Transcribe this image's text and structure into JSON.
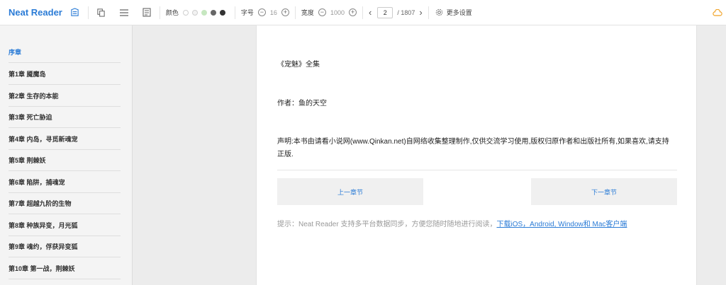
{
  "toolbar": {
    "app_name": "Neat Reader",
    "color_label": "颜色",
    "font_label": "字号",
    "font_size": "16",
    "width_label": "宽度",
    "width_value": "1000",
    "page_current": "2",
    "page_total": "/ 1807",
    "more_settings": "更多设置",
    "color_dots": [
      "#ffffff",
      "#f2f2f2",
      "#c6e7c0",
      "#666666",
      "#333333"
    ]
  },
  "sidebar": {
    "items": [
      {
        "label": "序章",
        "active": true
      },
      {
        "label": "第1章 魇魔岛"
      },
      {
        "label": "第2章 生存的本能"
      },
      {
        "label": "第3章 死亡胁迫"
      },
      {
        "label": "第4章 内岛，寻觅新魂宠"
      },
      {
        "label": "第5章 荆棘妖"
      },
      {
        "label": "第6章 陷阱，捕魂宠"
      },
      {
        "label": "第7章 超越九阶的生物"
      },
      {
        "label": "第8章 种族异变，月光狐"
      },
      {
        "label": "第9章 魂约，俘获异变狐"
      },
      {
        "label": "第10章 第一战，荆棘妖"
      }
    ]
  },
  "content": {
    "title": "《宠魅》全集",
    "author": "作者：鱼的天空",
    "statement_line1": "声明:本书由请看小说网(www.Qinkan.net)自网络收集整理制作,仅供交流学习使用,版权归原作者和出版社所有,如果喜欢,请支持",
    "statement_line2": "正版.",
    "prev_chapter": "上一章节",
    "next_chapter": "下一章节",
    "hint_text": "提示：Neat Reader 支持多平台数据同步，方便您随时随地进行阅读，",
    "hint_link": "下载iOS，Android, Window和 Mac客户端"
  }
}
